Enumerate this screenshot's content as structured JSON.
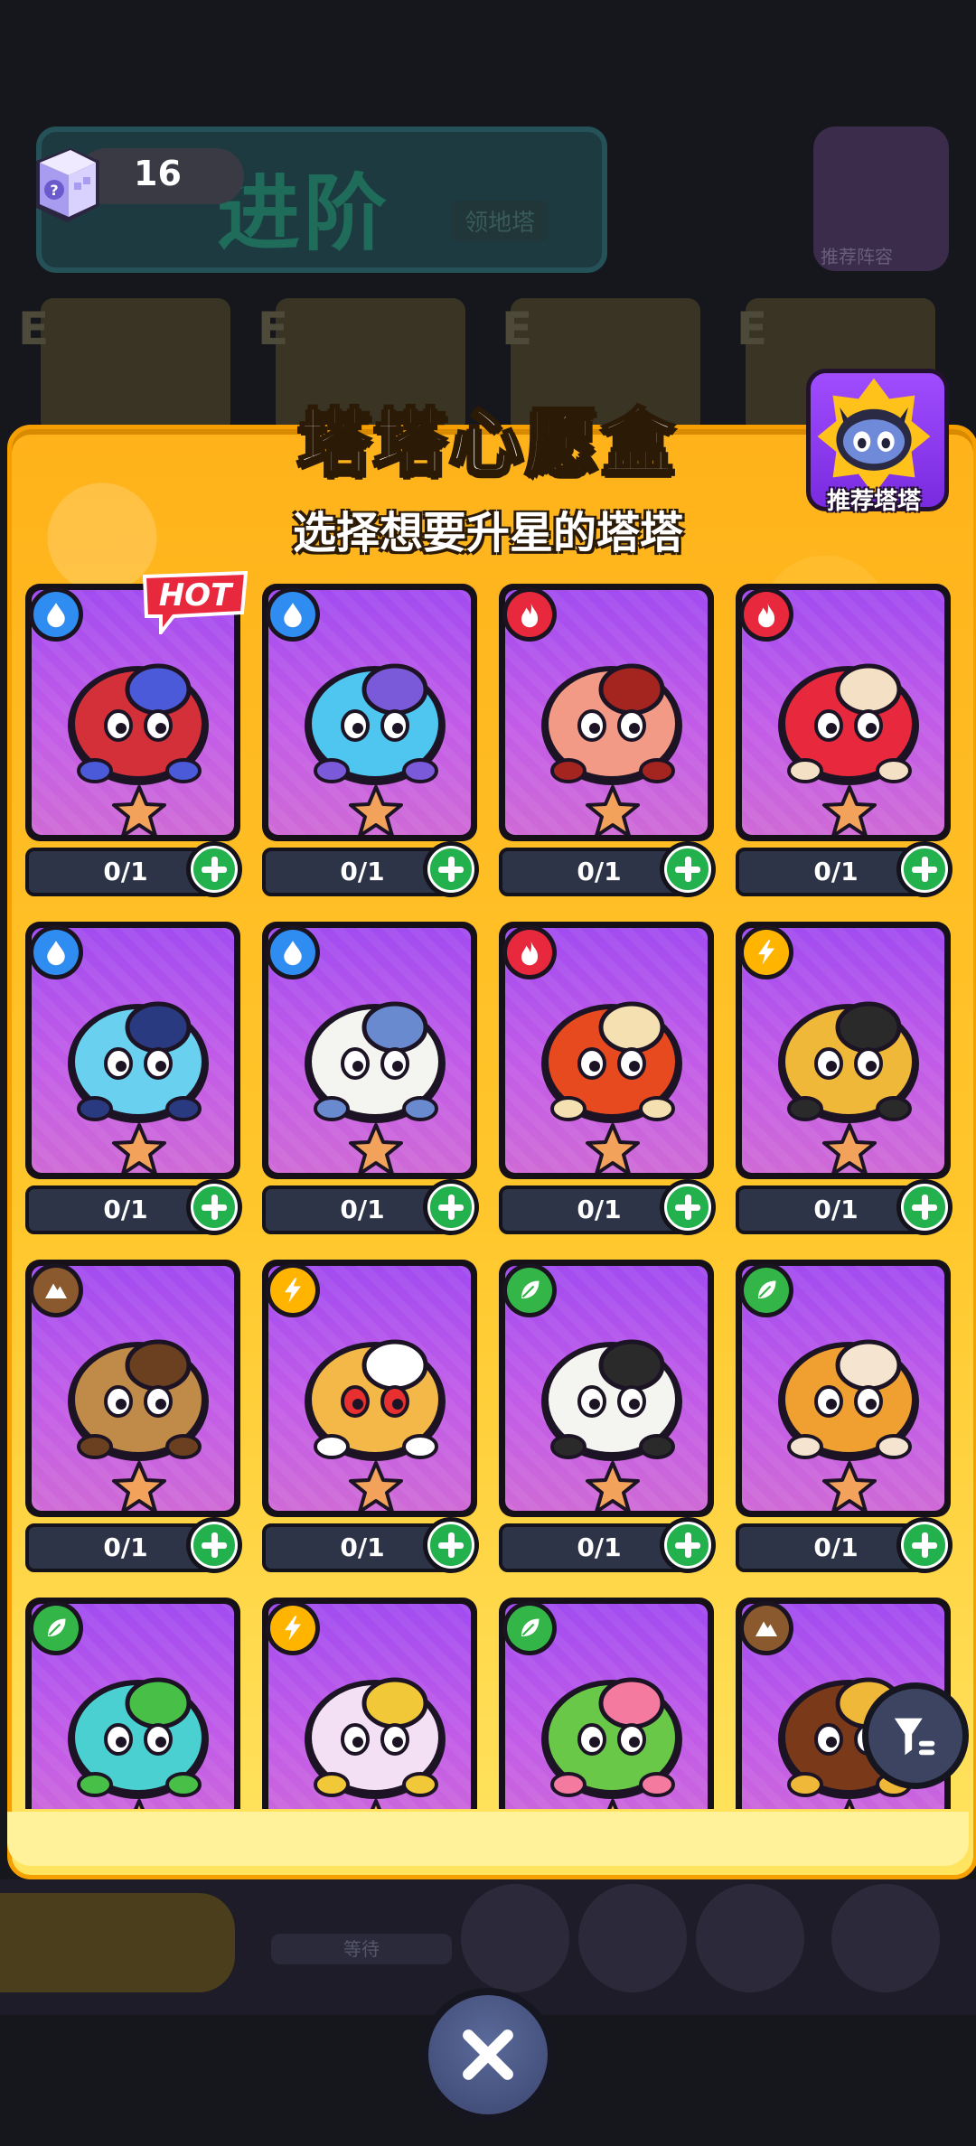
{
  "currency": {
    "value": "16",
    "icon": "mystery-box-icon"
  },
  "background": {
    "banner_text": "进阶",
    "banner_sub": "领地塔",
    "avatar_label": "推荐阵容",
    "bottom_label": "等待"
  },
  "panel": {
    "title": "塔塔心愿盒",
    "subtitle": "选择想要升星的塔塔",
    "recommend_label": "推荐塔塔",
    "hot_label": "HOT"
  },
  "colors": {
    "water": "#2f8cf0",
    "fire": "#e8283c",
    "electric": "#ffb400",
    "earth": "#8a5a2e",
    "grass": "#33b548",
    "panel": "#ffbf25",
    "card": "#b355ee"
  },
  "cards": [
    {
      "element": "water",
      "icon": "water-drop-icon",
      "creature": "crab-creature",
      "count": "0/1",
      "hot": true
    },
    {
      "element": "water",
      "icon": "water-drop-icon",
      "creature": "chameleon-creature",
      "count": "0/1"
    },
    {
      "element": "fire",
      "icon": "flame-icon",
      "creature": "pig-bowl-creature",
      "count": "0/1"
    },
    {
      "element": "fire",
      "icon": "flame-icon",
      "creature": "ladybug-creature",
      "count": "0/1"
    },
    {
      "element": "water",
      "icon": "water-drop-icon",
      "creature": "fish-creature",
      "count": "0/1"
    },
    {
      "element": "water",
      "icon": "water-drop-icon",
      "creature": "polar-bear-creature",
      "count": "0/1"
    },
    {
      "element": "fire",
      "icon": "flame-icon",
      "creature": "fire-bird-creature",
      "count": "0/1"
    },
    {
      "element": "electric",
      "icon": "lightning-icon",
      "creature": "caged-lion-creature",
      "count": "0/1"
    },
    {
      "element": "earth",
      "icon": "mountain-icon",
      "creature": "turtle-creature",
      "count": "0/1"
    },
    {
      "element": "electric",
      "icon": "lightning-icon",
      "creature": "fox-creature",
      "count": "0/1"
    },
    {
      "element": "grass",
      "icon": "leaf-icon",
      "creature": "panda-creature",
      "count": "0/1"
    },
    {
      "element": "grass",
      "icon": "leaf-icon",
      "creature": "sunflower-creature",
      "count": "0/1"
    },
    {
      "element": "grass",
      "icon": "leaf-icon",
      "creature": "bag-frog-creature",
      "count": ""
    },
    {
      "element": "electric",
      "icon": "lightning-icon",
      "creature": "star-cat-creature",
      "count": ""
    },
    {
      "element": "grass",
      "icon": "leaf-icon",
      "creature": "cactus-creature",
      "count": ""
    },
    {
      "element": "earth",
      "icon": "mountain-icon",
      "creature": "snail-creature",
      "count": ""
    }
  ]
}
